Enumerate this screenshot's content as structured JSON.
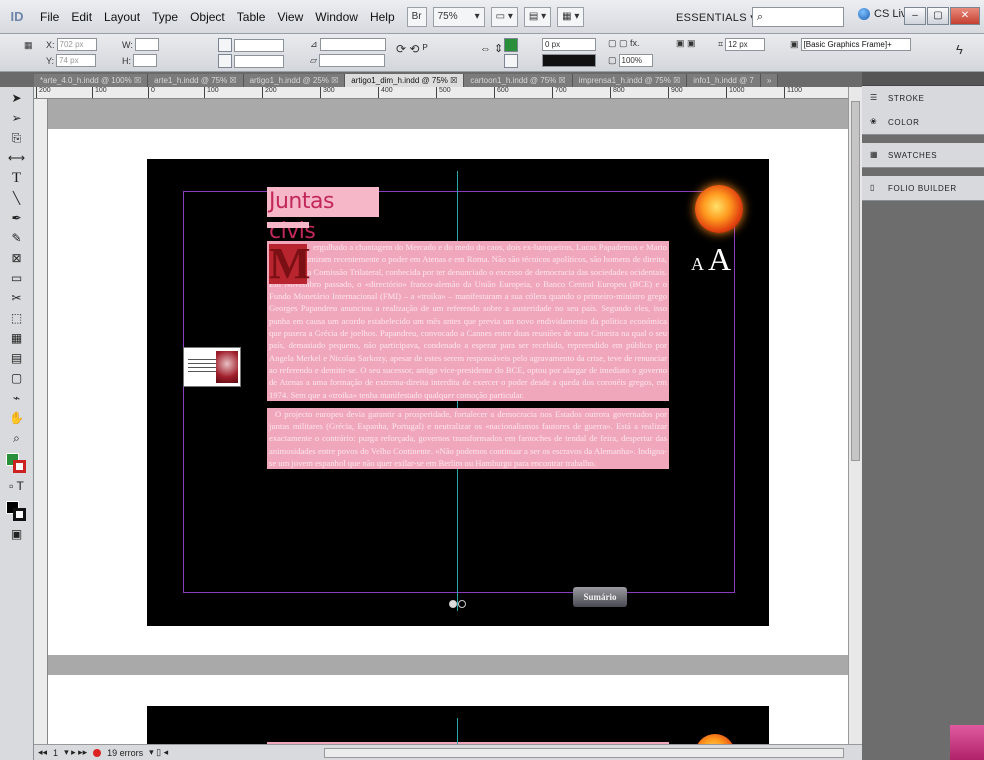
{
  "app": {
    "logo": "ID"
  },
  "menu": [
    "File",
    "Edit",
    "Layout",
    "Type",
    "Object",
    "Table",
    "View",
    "Window",
    "Help"
  ],
  "menubar": {
    "zoom": "75%",
    "workspace": "ESSENTIALS ▾",
    "search_placeholder": "",
    "cs_live": "CS Live"
  },
  "control": {
    "x": "702 px",
    "y": "74 px",
    "w": "",
    "h": "",
    "stroke_weight": "0 px",
    "opacity": "100%",
    "size": "12 px",
    "object_style": "[Basic Graphics Frame]+"
  },
  "tabs": [
    "*arte_4.0_h.indd @ 100% ☒",
    "arte1_h.indd @ 75% ☒",
    "artigo1_h.indd @ 25% ☒",
    "artigo1_dim_h.indd @ 75% ☒",
    "cartoon1_h.indd @ 75% ☒",
    "imprensa1_h.indd @ 75% ☒",
    "info1_h.indd @ 7"
  ],
  "active_tab_index": 3,
  "ruler": [
    "200",
    "100",
    "0",
    "100",
    "200",
    "300",
    "400",
    "500",
    "600",
    "700",
    "800",
    "900",
    "1000",
    "1100"
  ],
  "document": {
    "title": "Juntas civis",
    "dropcap": "M",
    "paragraph1": "ergulhado a chantagem do Mercado e do medo do caos, dois ex-banqueiros, Lucas Papademos e Mario Monti, assumiram recentemente o poder em Atenas e em Roma. Não são técnicos apolíticos, são homens de direita, membros da Comissão Trilateral, conhecida por ter denunciado o excesso de democracia das sociedades ocidentais. Em Novembro passado, o «directório» franco-alemão da União Europeia, o Banco Central Europeu (BCE) e o Fundo Monetário Internacional (FMI) – a «troika» – manifestaram a sua cólera quando o primeiro-ministro grego Georges Papandreu anunciou a realização de um referendo sobre a austeridade no seu país. Segundo eles, isso punha em causa um acordo estabelecido um mês antes que previa um novo endividamento da política económica que pusera a Grécia de joelhos. Papandreu, convocado a Cannes entre duas reuniões de uma Cimeira na qual o seu país, demasiado pequeno, não participava, condenado a esperar para ser recebido, repreendido em público por Angela Merkel e Nicolas Sarkozy, apesar de estes serem responsáveis pelo agravamento da crise, teve de renunciar ao referendo e demitir-se. O seu sucessor, antigo vice-presidente do BCE, optou por alargar de imediato o governo de Atenas a uma formação de extrema-direita interdita de exercer o poder desde a queda dos coronéis gregos, em 1974. Sem que a «troika» tenha manifestado qualquer comoção particular.",
    "paragraph2": "O projecto europeu devia garantir a prosperidade, fortalecer a democracia nos Estados outrora governados por juntas militares (Grécia, Espanha, Portugal) e neutralizar os «nacionalismos fautores de guerra». Está a realizar exactamente o contrário: purga reforçada, governos transformados em fantoches de tendal de feira, despertar das animosidades entre povos do Velho Continente. «Não podemos continuar a ser os escravos da Alemanha». Indigna-se um jovem espanhol que não quer exilar-se em Berlim ou Hamburgo para encontrar trabalho.",
    "aa_small": "A",
    "aa_big": "A",
    "sumario_button": "Sumário"
  },
  "status": {
    "page": "1",
    "errors": "19 errors"
  },
  "panels": [
    {
      "label": "STROKE",
      "icon": "stroke-icon"
    },
    {
      "label": "COLOR",
      "icon": "color-icon"
    },
    {
      "label": "SWATCHES",
      "icon": "swatches-icon"
    },
    {
      "label": "FOLIO BUILDER",
      "icon": "folio-builder-icon"
    }
  ],
  "colors": {
    "title_bg": "#f6b8c8",
    "text_highlight": "#f0a6bb",
    "margin_guide": "#8a3cc0",
    "center_guide": "#2aa6a6"
  }
}
